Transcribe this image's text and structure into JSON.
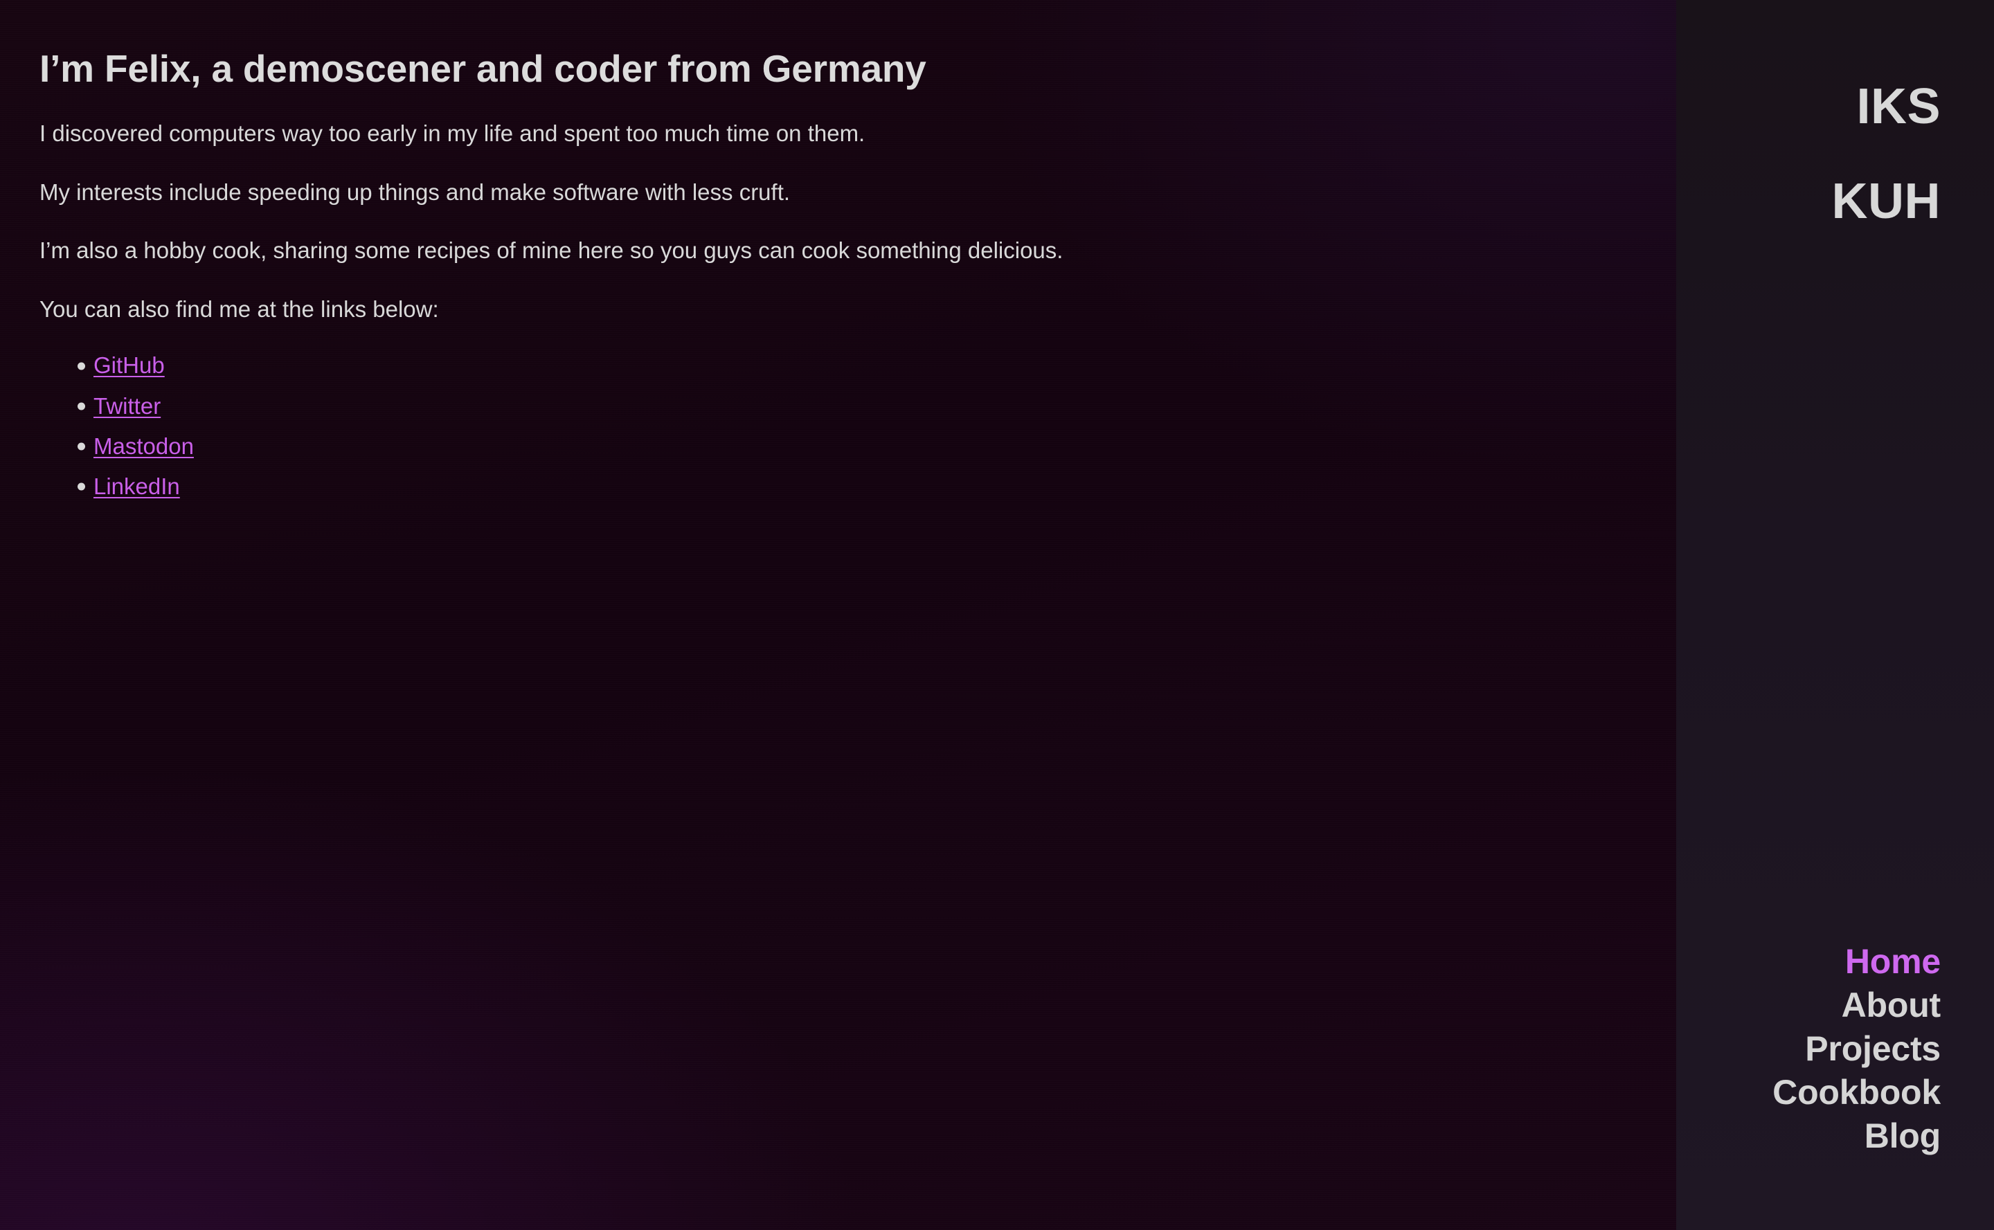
{
  "site": {
    "brand_line_1": "IKS",
    "brand_line_2": "KUH",
    "accent_color": "#ce69ef",
    "link_color": "#c95fe9",
    "text_color": "#d9d9d9",
    "content_bg": "#160410",
    "sidebar_bg": "#1c1420"
  },
  "main": {
    "title": "I’m Felix, a demoscener and coder from Germany",
    "paragraphs": [
      "I discovered computers way too early in my life and spent too much time on them.",
      "My interests include speeding up things and make software with less cruft.",
      "I’m also a hobby cook, sharing some recipes of mine here so you guys can cook something delicious.",
      "You can also find me at the links below:"
    ],
    "links": [
      {
        "label": "GitHub"
      },
      {
        "label": "Twitter"
      },
      {
        "label": "Mastodon"
      },
      {
        "label": "LinkedIn"
      }
    ]
  },
  "nav": {
    "items": [
      {
        "label": "Home",
        "active": true
      },
      {
        "label": "About",
        "active": false
      },
      {
        "label": "Projects",
        "active": false
      },
      {
        "label": "Cookbook",
        "active": false
      },
      {
        "label": "Blog",
        "active": false
      }
    ]
  }
}
